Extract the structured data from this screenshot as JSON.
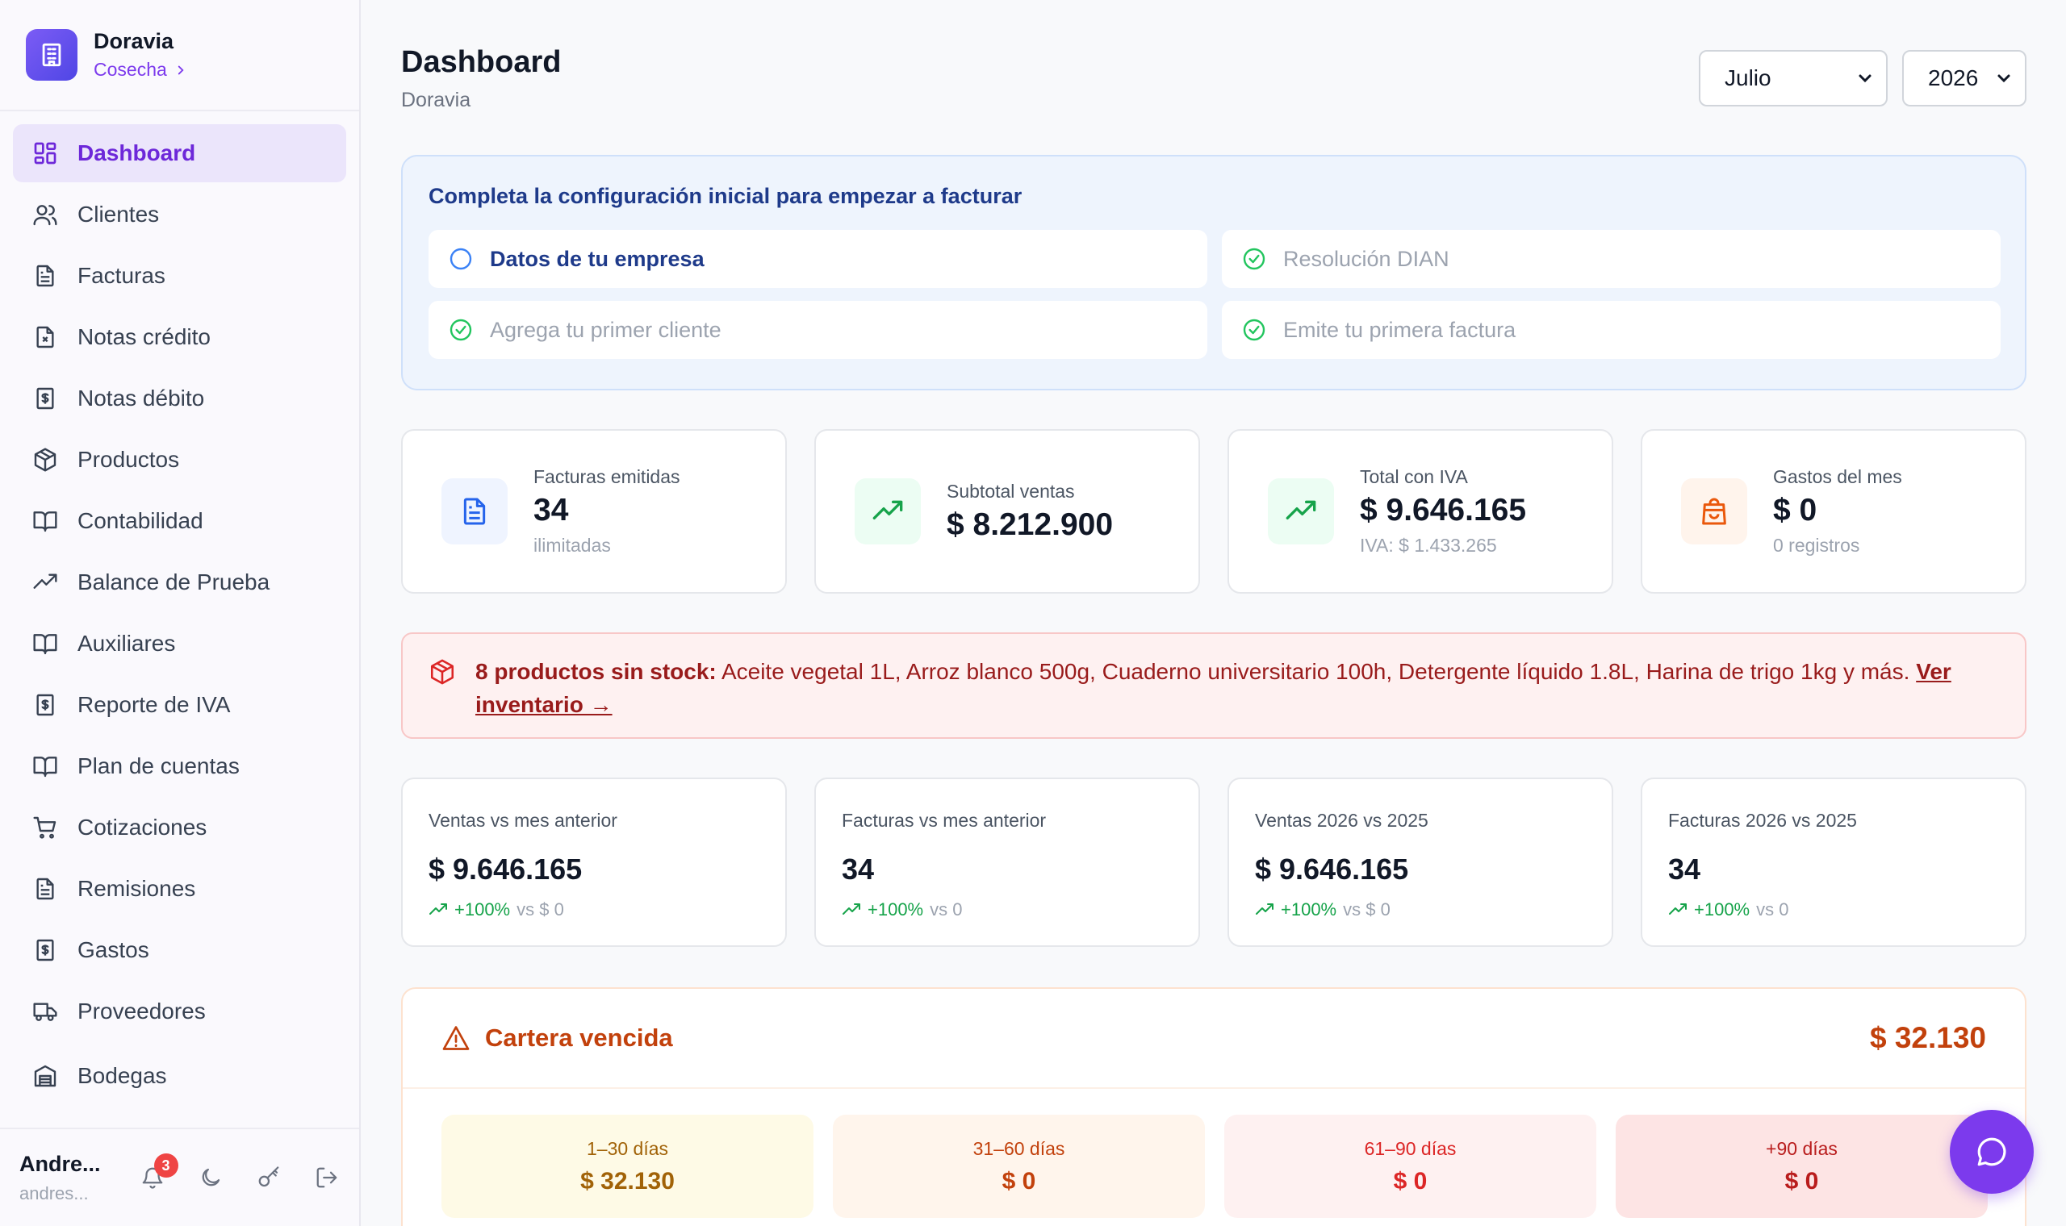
{
  "brand": {
    "name": "Doravia",
    "subtitle": "Cosecha",
    "logo_icon": "building-icon"
  },
  "nav": [
    {
      "label": "Dashboard",
      "icon": "dashboard-grid-icon",
      "active": true
    },
    {
      "label": "Clientes",
      "icon": "users-icon"
    },
    {
      "label": "Facturas",
      "icon": "file-text-icon"
    },
    {
      "label": "Notas crédito",
      "icon": "file-x-icon"
    },
    {
      "label": "Notas débito",
      "icon": "file-dollar-icon"
    },
    {
      "label": "Productos",
      "icon": "package-icon"
    },
    {
      "label": "Contabilidad",
      "icon": "book-open-icon"
    },
    {
      "label": "Balance de Prueba",
      "icon": "trending-up-icon"
    },
    {
      "label": "Auxiliares",
      "icon": "book-open-icon"
    },
    {
      "label": "Reporte de IVA",
      "icon": "file-dollar-icon"
    },
    {
      "label": "Plan de cuentas",
      "icon": "book-open-icon"
    },
    {
      "label": "Cotizaciones",
      "icon": "cart-icon"
    },
    {
      "label": "Remisiones",
      "icon": "file-text-icon"
    },
    {
      "label": "Gastos",
      "icon": "file-dollar-icon"
    },
    {
      "label": "Proveedores",
      "icon": "truck-icon"
    },
    {
      "label": "Bodegas",
      "icon": "warehouse-icon"
    }
  ],
  "user": {
    "name": "Andre...",
    "email": "andres...",
    "notifications": "3"
  },
  "header": {
    "title": "Dashboard",
    "subtitle": "Doravia",
    "month": "Julio",
    "year": "2026"
  },
  "setup": {
    "title": "Completa la configuración inicial para empezar a facturar",
    "steps": [
      {
        "label": "Datos de tu empresa",
        "done": false
      },
      {
        "label": "Resolución DIAN",
        "done": true
      },
      {
        "label": "Agrega tu primer cliente",
        "done": true
      },
      {
        "label": "Emite tu primera factura",
        "done": true
      }
    ]
  },
  "stats": [
    {
      "label": "Facturas emitidas",
      "value": "34",
      "foot": "ilimitadas",
      "icon": "file-text-icon"
    },
    {
      "label": "Subtotal ventas",
      "value": "$ 8.212.900",
      "foot": "",
      "icon": "trending-up-icon"
    },
    {
      "label": "Total con IVA",
      "value": "$ 9.646.165",
      "foot": "IVA: $ 1.433.265",
      "icon": "trending-up-icon"
    },
    {
      "label": "Gastos del mes",
      "value": "$ 0",
      "foot": "0 registros",
      "icon": "shopping-bag-icon"
    }
  ],
  "stock_alert": {
    "strong": "8 productos sin stock:",
    "text": " Aceite vegetal 1L, Arroz blanco 500g, Cuaderno universitario 100h, Detergente líquido 1.8L, Harina de trigo 1kg y más. ",
    "link": "Ver inventario →"
  },
  "comparisons": [
    {
      "label": "Ventas vs mes anterior",
      "value": "$ 9.646.165",
      "pct": "+100%",
      "vs": "vs $ 0"
    },
    {
      "label": "Facturas vs mes anterior",
      "value": "34",
      "pct": "+100%",
      "vs": "vs 0"
    },
    {
      "label": "Ventas 2026 vs 2025",
      "value": "$ 9.646.165",
      "pct": "+100%",
      "vs": "vs $ 0"
    },
    {
      "label": "Facturas 2026 vs 2025",
      "value": "34",
      "pct": "+100%",
      "vs": "vs 0"
    }
  ],
  "cartera": {
    "title": "Cartera vencida",
    "total": "$ 32.130",
    "buckets": [
      {
        "label": "1–30 días",
        "value": "$ 32.130"
      },
      {
        "label": "31–60 días",
        "value": "$ 0"
      },
      {
        "label": "61–90 días",
        "value": "$ 0"
      },
      {
        "label": "+90 días",
        "value": "$ 0"
      }
    ]
  },
  "colors": {
    "accent": "#7c3aed",
    "alert": "#991b1b",
    "success": "#16a34a",
    "warning": "#c2410c"
  }
}
